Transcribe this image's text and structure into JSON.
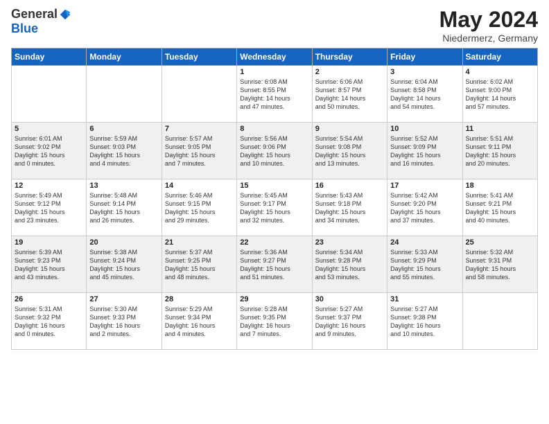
{
  "logo": {
    "general": "General",
    "blue": "Blue"
  },
  "header": {
    "title": "May 2024",
    "location": "Niedermerz, Germany"
  },
  "weekdays": [
    "Sunday",
    "Monday",
    "Tuesday",
    "Wednesday",
    "Thursday",
    "Friday",
    "Saturday"
  ],
  "weeks": [
    [
      {
        "day": "",
        "info": ""
      },
      {
        "day": "",
        "info": ""
      },
      {
        "day": "",
        "info": ""
      },
      {
        "day": "1",
        "info": "Sunrise: 6:08 AM\nSunset: 8:55 PM\nDaylight: 14 hours\nand 47 minutes."
      },
      {
        "day": "2",
        "info": "Sunrise: 6:06 AM\nSunset: 8:57 PM\nDaylight: 14 hours\nand 50 minutes."
      },
      {
        "day": "3",
        "info": "Sunrise: 6:04 AM\nSunset: 8:58 PM\nDaylight: 14 hours\nand 54 minutes."
      },
      {
        "day": "4",
        "info": "Sunrise: 6:02 AM\nSunset: 9:00 PM\nDaylight: 14 hours\nand 57 minutes."
      }
    ],
    [
      {
        "day": "5",
        "info": "Sunrise: 6:01 AM\nSunset: 9:02 PM\nDaylight: 15 hours\nand 0 minutes."
      },
      {
        "day": "6",
        "info": "Sunrise: 5:59 AM\nSunset: 9:03 PM\nDaylight: 15 hours\nand 4 minutes."
      },
      {
        "day": "7",
        "info": "Sunrise: 5:57 AM\nSunset: 9:05 PM\nDaylight: 15 hours\nand 7 minutes."
      },
      {
        "day": "8",
        "info": "Sunrise: 5:56 AM\nSunset: 9:06 PM\nDaylight: 15 hours\nand 10 minutes."
      },
      {
        "day": "9",
        "info": "Sunrise: 5:54 AM\nSunset: 9:08 PM\nDaylight: 15 hours\nand 13 minutes."
      },
      {
        "day": "10",
        "info": "Sunrise: 5:52 AM\nSunset: 9:09 PM\nDaylight: 15 hours\nand 16 minutes."
      },
      {
        "day": "11",
        "info": "Sunrise: 5:51 AM\nSunset: 9:11 PM\nDaylight: 15 hours\nand 20 minutes."
      }
    ],
    [
      {
        "day": "12",
        "info": "Sunrise: 5:49 AM\nSunset: 9:12 PM\nDaylight: 15 hours\nand 23 minutes."
      },
      {
        "day": "13",
        "info": "Sunrise: 5:48 AM\nSunset: 9:14 PM\nDaylight: 15 hours\nand 26 minutes."
      },
      {
        "day": "14",
        "info": "Sunrise: 5:46 AM\nSunset: 9:15 PM\nDaylight: 15 hours\nand 29 minutes."
      },
      {
        "day": "15",
        "info": "Sunrise: 5:45 AM\nSunset: 9:17 PM\nDaylight: 15 hours\nand 32 minutes."
      },
      {
        "day": "16",
        "info": "Sunrise: 5:43 AM\nSunset: 9:18 PM\nDaylight: 15 hours\nand 34 minutes."
      },
      {
        "day": "17",
        "info": "Sunrise: 5:42 AM\nSunset: 9:20 PM\nDaylight: 15 hours\nand 37 minutes."
      },
      {
        "day": "18",
        "info": "Sunrise: 5:41 AM\nSunset: 9:21 PM\nDaylight: 15 hours\nand 40 minutes."
      }
    ],
    [
      {
        "day": "19",
        "info": "Sunrise: 5:39 AM\nSunset: 9:23 PM\nDaylight: 15 hours\nand 43 minutes."
      },
      {
        "day": "20",
        "info": "Sunrise: 5:38 AM\nSunset: 9:24 PM\nDaylight: 15 hours\nand 45 minutes."
      },
      {
        "day": "21",
        "info": "Sunrise: 5:37 AM\nSunset: 9:25 PM\nDaylight: 15 hours\nand 48 minutes."
      },
      {
        "day": "22",
        "info": "Sunrise: 5:36 AM\nSunset: 9:27 PM\nDaylight: 15 hours\nand 51 minutes."
      },
      {
        "day": "23",
        "info": "Sunrise: 5:34 AM\nSunset: 9:28 PM\nDaylight: 15 hours\nand 53 minutes."
      },
      {
        "day": "24",
        "info": "Sunrise: 5:33 AM\nSunset: 9:29 PM\nDaylight: 15 hours\nand 55 minutes."
      },
      {
        "day": "25",
        "info": "Sunrise: 5:32 AM\nSunset: 9:31 PM\nDaylight: 15 hours\nand 58 minutes."
      }
    ],
    [
      {
        "day": "26",
        "info": "Sunrise: 5:31 AM\nSunset: 9:32 PM\nDaylight: 16 hours\nand 0 minutes."
      },
      {
        "day": "27",
        "info": "Sunrise: 5:30 AM\nSunset: 9:33 PM\nDaylight: 16 hours\nand 2 minutes."
      },
      {
        "day": "28",
        "info": "Sunrise: 5:29 AM\nSunset: 9:34 PM\nDaylight: 16 hours\nand 4 minutes."
      },
      {
        "day": "29",
        "info": "Sunrise: 5:28 AM\nSunset: 9:35 PM\nDaylight: 16 hours\nand 7 minutes."
      },
      {
        "day": "30",
        "info": "Sunrise: 5:27 AM\nSunset: 9:37 PM\nDaylight: 16 hours\nand 9 minutes."
      },
      {
        "day": "31",
        "info": "Sunrise: 5:27 AM\nSunset: 9:38 PM\nDaylight: 16 hours\nand 10 minutes."
      },
      {
        "day": "",
        "info": ""
      }
    ]
  ]
}
